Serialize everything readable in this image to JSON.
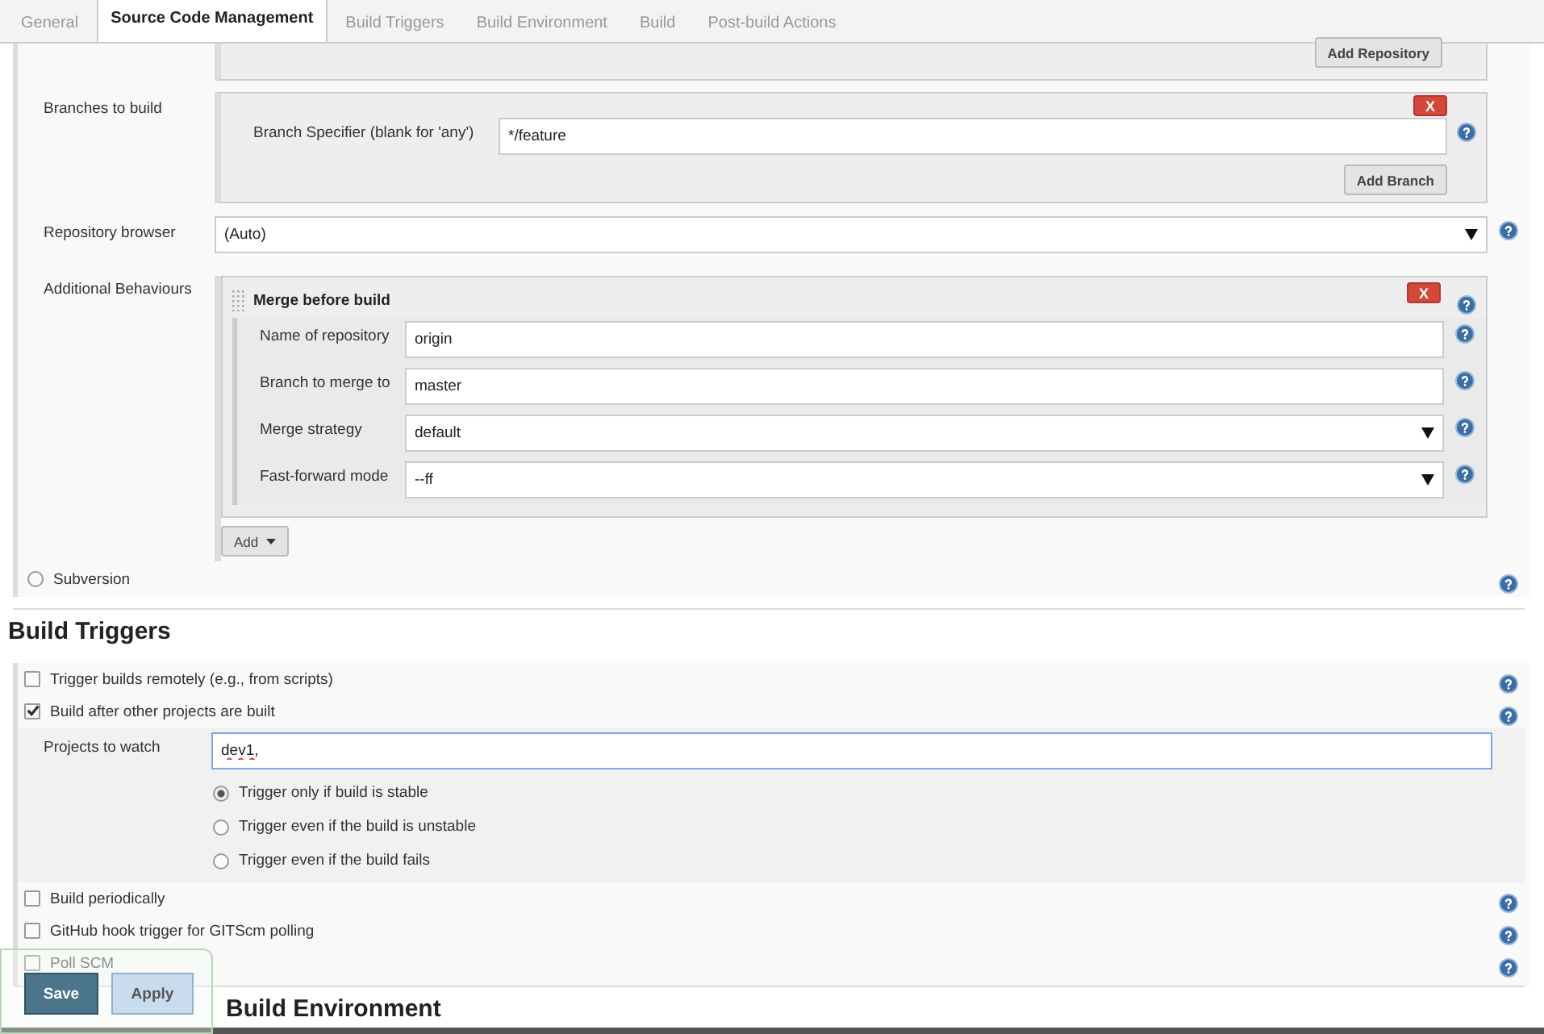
{
  "tabs": [
    {
      "label": "General",
      "selected": false
    },
    {
      "label": "Source Code Management",
      "selected": true
    },
    {
      "label": "Build Triggers",
      "selected": false
    },
    {
      "label": "Build Environment",
      "selected": false
    },
    {
      "label": "Build",
      "selected": false
    },
    {
      "label": "Post-build Actions",
      "selected": false
    }
  ],
  "scm": {
    "add_repository_button": "Add Repository",
    "branches": {
      "label": "Branches to build",
      "specifier_label": "Branch Specifier (blank for 'any')",
      "specifier_value": "*/feature",
      "delete_button": "X",
      "add_branch_button": "Add Branch"
    },
    "repository_browser": {
      "label": "Repository browser",
      "value": "(Auto)"
    },
    "additional_behaviours": {
      "label": "Additional Behaviours",
      "title": "Merge before build",
      "delete_button": "X",
      "add_button": "Add",
      "fields": [
        {
          "label": "Name of repository",
          "value": "origin",
          "kind": "text"
        },
        {
          "label": "Branch to merge to",
          "value": "master",
          "kind": "text"
        },
        {
          "label": "Merge strategy",
          "value": "default",
          "kind": "select"
        },
        {
          "label": "Fast-forward mode",
          "value": "--ff",
          "kind": "select"
        }
      ]
    },
    "subversion": {
      "label": "Subversion",
      "selected": false
    }
  },
  "build_triggers": {
    "heading": "Build Triggers",
    "options": [
      {
        "label": "Trigger builds remotely (e.g., from scripts)",
        "checked": false
      },
      {
        "label": "Build after other projects are built",
        "checked": true,
        "projects_label": "Projects to watch",
        "projects_value": "dev1,",
        "radios": [
          {
            "label": "Trigger only if build is stable",
            "selected": true
          },
          {
            "label": "Trigger even if the build is unstable",
            "selected": false
          },
          {
            "label": "Trigger even if the build fails",
            "selected": false
          }
        ]
      },
      {
        "label": "Build periodically",
        "checked": false
      },
      {
        "label": "GitHub hook trigger for GITScm polling",
        "checked": false
      },
      {
        "label": "Poll SCM",
        "checked": false
      }
    ]
  },
  "build_environment": {
    "heading": "Build Environment"
  },
  "save_button": "Save",
  "apply_button": "Apply"
}
